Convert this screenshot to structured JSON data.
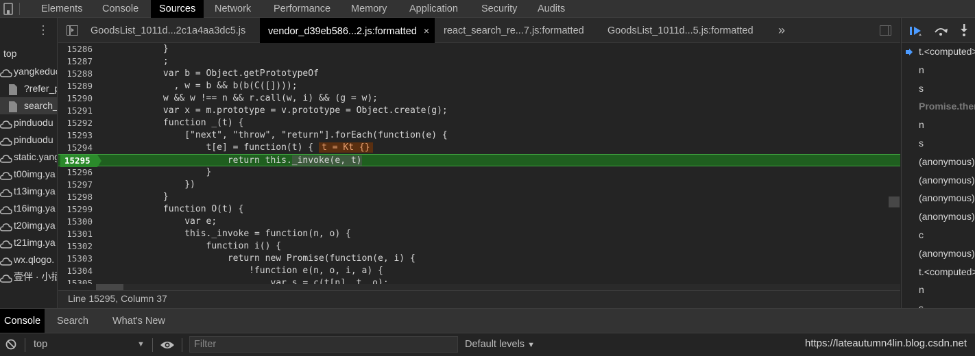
{
  "main_tabs": [
    {
      "label": "Elements"
    },
    {
      "label": "Console"
    },
    {
      "label": "Sources",
      "active": true
    },
    {
      "label": "Network"
    },
    {
      "label": "Performance"
    },
    {
      "label": "Memory"
    },
    {
      "label": "Application"
    },
    {
      "label": "Security"
    },
    {
      "label": "Audits"
    }
  ],
  "navigator": {
    "items": [
      {
        "label": "top",
        "icon": "none"
      },
      {
        "label": "yangkeduo",
        "icon": "cloud-icon"
      },
      {
        "label": "?refer_p",
        "icon": "file-icon"
      },
      {
        "label": "search_",
        "icon": "file-icon",
        "selected": true
      },
      {
        "label": "pinduodu",
        "icon": "cloud-icon"
      },
      {
        "label": "pinduodu",
        "icon": "cloud-icon"
      },
      {
        "label": "static.yang",
        "icon": "cloud-icon"
      },
      {
        "label": "t00img.ya",
        "icon": "cloud-icon"
      },
      {
        "label": "t13img.ya",
        "icon": "cloud-icon"
      },
      {
        "label": "t16img.ya",
        "icon": "cloud-icon"
      },
      {
        "label": "t20img.ya",
        "icon": "cloud-icon"
      },
      {
        "label": "t21img.ya",
        "icon": "cloud-icon"
      },
      {
        "label": "wx.qlogo.",
        "icon": "cloud-icon"
      },
      {
        "label": "壹伴 · 小插",
        "icon": "cloud-icon"
      }
    ]
  },
  "file_tabs": [
    {
      "label": "GoodsList_1011d...2c1a4aa3dc5.js"
    },
    {
      "label": "vendor_d39eb586...2.js:formatted",
      "active": true,
      "close": "×"
    },
    {
      "label": "react_search_re...7.js:formatted"
    },
    {
      "label": "GoodsList_1011d...5.js:formatted"
    }
  ],
  "more_tabs": "»",
  "code_lines": [
    {
      "num": "15286",
      "text": "            }"
    },
    {
      "num": "15287",
      "text": "            ;"
    },
    {
      "num": "15288",
      "text": "            var b = Object.getPrototypeOf"
    },
    {
      "num": "15289",
      "text": "              , w = b && b(b(C([])));"
    },
    {
      "num": "15290",
      "text": "            w && w !== n && r.call(w, i) && (g = w);"
    },
    {
      "num": "15291",
      "text": "            var x = m.prototype = v.prototype = Object.create(g);"
    },
    {
      "num": "15292",
      "text": "            function _(t) {"
    },
    {
      "num": "15293",
      "text": "                [\"next\", \"throw\", \"return\"].forEach(function(e) {"
    },
    {
      "num": "15294",
      "text": "                    t[e] = function(t) {",
      "inline_value": "t = Kt {}"
    },
    {
      "num": "15295",
      "text": "                        return this.",
      "highlight": "_invoke(e, t)",
      "exec": true
    },
    {
      "num": "15296",
      "text": "                    }"
    },
    {
      "num": "15297",
      "text": "                })"
    },
    {
      "num": "15298",
      "text": "            }"
    },
    {
      "num": "15299",
      "text": "            function O(t) {"
    },
    {
      "num": "15300",
      "text": "                var e;"
    },
    {
      "num": "15301",
      "text": "                this._invoke = function(n, o) {"
    },
    {
      "num": "15302",
      "text": "                    function i() {"
    },
    {
      "num": "15303",
      "text": "                        return new Promise(function(e, i) {"
    },
    {
      "num": "15304",
      "text": "                            !function e(n, o, i, a) {"
    },
    {
      "num": "15305",
      "text": "                                var s = c(t[n], t, o);"
    }
  ],
  "status_line": "Line 15295, Column 37",
  "call_stack": [
    {
      "label": "t.<computed>",
      "current": true
    },
    {
      "label": "n"
    },
    {
      "label": "s"
    },
    {
      "label": "Promise.then",
      "async": true
    },
    {
      "label": "n"
    },
    {
      "label": "s"
    },
    {
      "label": "(anonymous)"
    },
    {
      "label": "(anonymous)"
    },
    {
      "label": "(anonymous)"
    },
    {
      "label": "(anonymous)"
    },
    {
      "label": "c"
    },
    {
      "label": "(anonymous)"
    },
    {
      "label": "t.<computed>"
    },
    {
      "label": "n"
    },
    {
      "label": "s"
    }
  ],
  "drawer_tabs": [
    {
      "label": "Console",
      "active": true
    },
    {
      "label": "Search"
    },
    {
      "label": "What's New"
    }
  ],
  "console_bar": {
    "context": "top",
    "context_arrow": "▼",
    "filter_placeholder": "Filter",
    "levels": "Default levels",
    "levels_arrow": "▼"
  },
  "watermark": "https://lateautumn4lin.blog.csdn.net",
  "colors": {
    "accent_blue": "#4c9bff",
    "exec_line": "#1f5f1f",
    "exec_gutter": "#2b8a2b",
    "inline_value_bg": "#5a2f10"
  }
}
